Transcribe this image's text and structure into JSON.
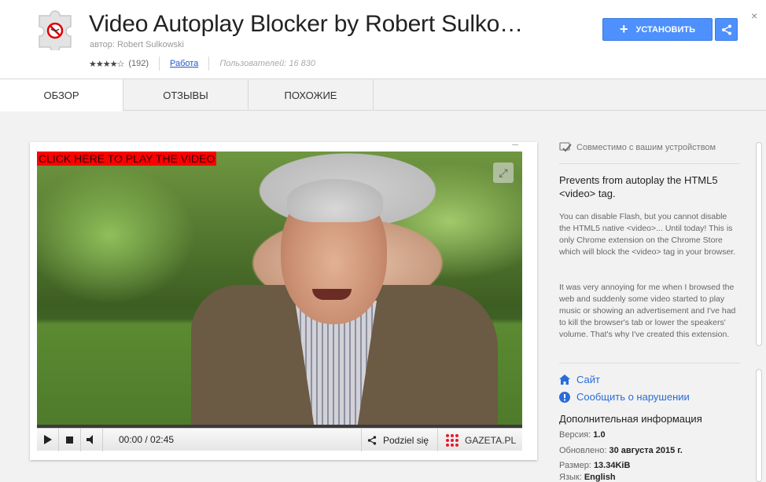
{
  "header": {
    "title": "Video Autoplay Blocker by Robert Sulko…",
    "author": "автор: Robert Sulkowski",
    "stars": "★★★★☆",
    "rating_count": "(192)",
    "category": "Работа",
    "users": "Пользователей: 16 830",
    "install_label": "УСТАНОВИТЬ",
    "close": "×"
  },
  "tabs": [
    {
      "label": "ОБЗОР",
      "active": true
    },
    {
      "label": "ОТЗЫВЫ",
      "active": false
    },
    {
      "label": "ПОХОЖИЕ",
      "active": false
    }
  ],
  "video": {
    "banner": "CLICK HERE TO PLAY THE VIDEO",
    "time": "00:00 / 02:45",
    "share_label": "Podziel się",
    "brand": "GAZETA.PL",
    "progress": 0
  },
  "sidebar": {
    "compat": "Совместимо с вашим устройством",
    "summary": "Prevents from autoplay the HTML5 <video> tag.",
    "desc1": "You can disable Flash, but you cannot disable the HTML5 native <video>... Until today! This is only Chrome extension on the Chrome Store which will block the <video> tag in your browser.",
    "desc2": "It was very annoying for me when I browsed the web and suddenly some video started to play music or showing an advertisement and I've had to kill the browser's tab or lower the speakers' volume. That's why I've created this extension.",
    "site_link": "Сайт",
    "report_link": "Сообщить о нарушении",
    "info_title": "Дополнительная информация",
    "version_label": "Версия:",
    "version": "1.0",
    "updated_label": "Обновлено:",
    "updated": "30 августа 2015 г.",
    "size_label": "Размер:",
    "size": "13.34KiB",
    "lang_label": "Язык:",
    "lang": "English"
  },
  "colors": {
    "accent": "#4d90fe",
    "link": "#2a6cd8",
    "banner": "#ff0000"
  }
}
